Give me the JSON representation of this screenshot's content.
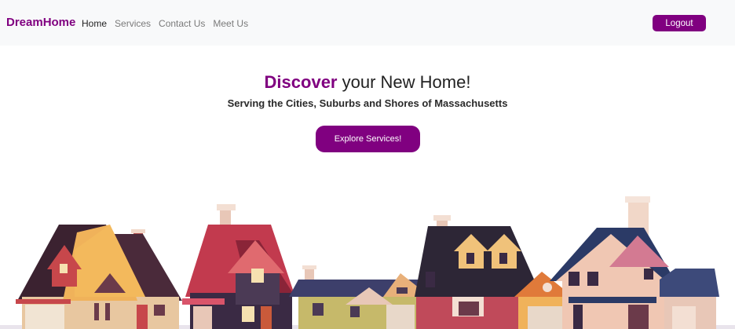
{
  "navbar": {
    "brand": "DreamHome",
    "links": [
      {
        "label": "Home",
        "active": true
      },
      {
        "label": "Services",
        "active": false
      },
      {
        "label": "Contact Us",
        "active": false
      },
      {
        "label": "Meet Us",
        "active": false
      }
    ],
    "logout_label": "Logout"
  },
  "hero": {
    "title_accent": "Discover",
    "title_rest": " your New Home!",
    "subtitle": "Serving the Cities, Suburbs and Shores of Massachusetts",
    "cta_label": "Explore Services!"
  },
  "colors": {
    "accent": "#800080",
    "navbar_bg": "#f8f9fa",
    "nav_link": "#7a7a7a",
    "nav_link_active": "#222222"
  },
  "illustration": {
    "name": "suburban-houses-illustration"
  }
}
